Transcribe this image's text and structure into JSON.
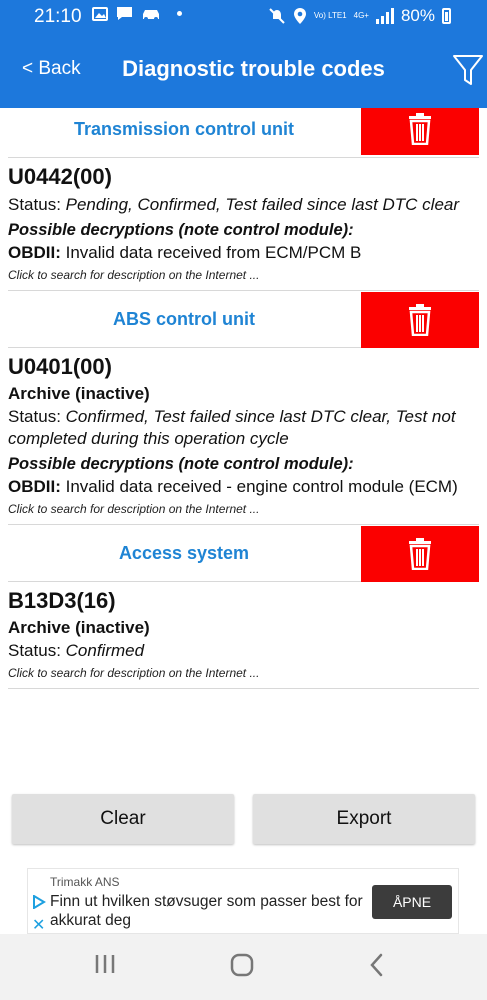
{
  "status_bar": {
    "time": "21:10",
    "battery": "80%",
    "network": "Vo) LTE1",
    "network_tech": "4G+",
    "icons": [
      "gallery-icon",
      "message-icon",
      "car-icon",
      "dot-icon",
      "mute-icon",
      "location-icon",
      "signal-icon",
      "battery-icon"
    ]
  },
  "app_bar": {
    "back_label": "< Back",
    "title": "Diagnostic trouble codes",
    "filter_icon": "filter-icon"
  },
  "sections": [
    {
      "unit": "Transmission control unit",
      "dtcs": [
        {
          "code": "U0442(00)",
          "archive": "",
          "status_label": "Status: ",
          "status_value": "Pending, Confirmed, Test failed since last DTC clear",
          "possible": "Possible decryptions (note control module):",
          "obd_label": "OBDII:",
          "obd_text": " Invalid data received from ECM/PCM B",
          "click_hint": "Click to search for description on the Internet ..."
        }
      ]
    },
    {
      "unit": "ABS control unit",
      "dtcs": [
        {
          "code": "U0401(00)",
          "archive": "Archive (inactive)",
          "status_label": "Status: ",
          "status_value": "Confirmed, Test failed since last DTC clear, Test not completed during this operation cycle",
          "possible": "Possible decryptions (note control module):",
          "obd_label": "OBDII:",
          "obd_text": " Invalid data received - engine control module (ECM)",
          "click_hint": "Click to search for description on the Internet ..."
        }
      ]
    },
    {
      "unit": "Access system",
      "dtcs": [
        {
          "code": "B13D3(16)",
          "archive": "Archive (inactive)",
          "status_label": "Status: ",
          "status_value": "Confirmed",
          "possible": "",
          "obd_label": "",
          "obd_text": "",
          "click_hint": "Click to search for description on the Internet ..."
        }
      ]
    }
  ],
  "buttons": {
    "clear": "Clear",
    "export": "Export"
  },
  "ad": {
    "sponsor": "Trimakk ANS",
    "text": "Finn ut hvilken støvsuger som passer best for akkurat deg",
    "cta": "ÅPNE"
  },
  "colors": {
    "primary": "#1d78dc",
    "unit_link": "#1f84d4",
    "delete": "#fb0000",
    "button": "#e0e0e0"
  }
}
